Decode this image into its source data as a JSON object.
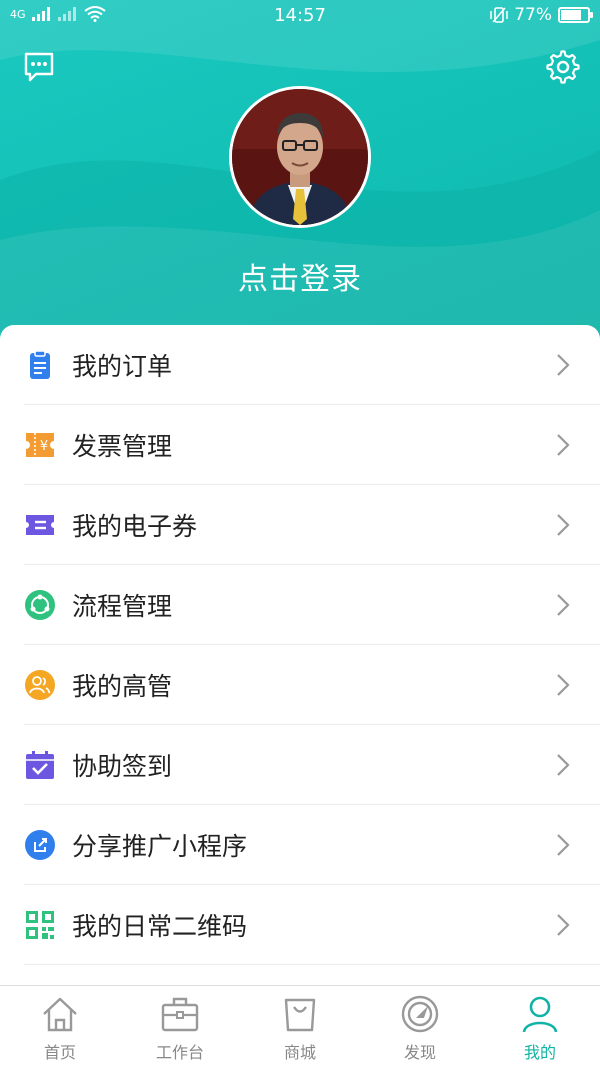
{
  "status_bar": {
    "network": "4G",
    "time": "14:57",
    "battery_percent": "77%",
    "battery_level": 0.77
  },
  "header": {
    "login_text": "点击登录"
  },
  "menu": [
    {
      "label": "我的订单",
      "icon": "clipboard-icon",
      "color": "#2f80ed"
    },
    {
      "label": "发票管理",
      "icon": "invoice-icon",
      "color": "#f39c33"
    },
    {
      "label": "我的电子券",
      "icon": "coupon-icon",
      "color": "#6e57e0"
    },
    {
      "label": "流程管理",
      "icon": "process-icon",
      "color": "#2ec27e"
    },
    {
      "label": "我的高管",
      "icon": "people-icon",
      "color": "#f5a623"
    },
    {
      "label": "协助签到",
      "icon": "calendar-check-icon",
      "color": "#6e57e0"
    },
    {
      "label": "分享推广小程序",
      "icon": "share-icon",
      "color": "#2f80ed"
    },
    {
      "label": "我的日常二维码",
      "icon": "qrcode-icon",
      "color": "#2ec27e"
    }
  ],
  "tabs": [
    {
      "label": "首页",
      "icon": "home-icon",
      "active": false
    },
    {
      "label": "工作台",
      "icon": "briefcase-icon",
      "active": false
    },
    {
      "label": "商城",
      "icon": "shopping-bag-icon",
      "active": false
    },
    {
      "label": "发现",
      "icon": "compass-icon",
      "active": false
    },
    {
      "label": "我的",
      "icon": "user-icon",
      "active": true
    }
  ],
  "colors": {
    "accent": "#11b3a6",
    "header": "#14c2b8",
    "inactive_tab": "#888888"
  }
}
